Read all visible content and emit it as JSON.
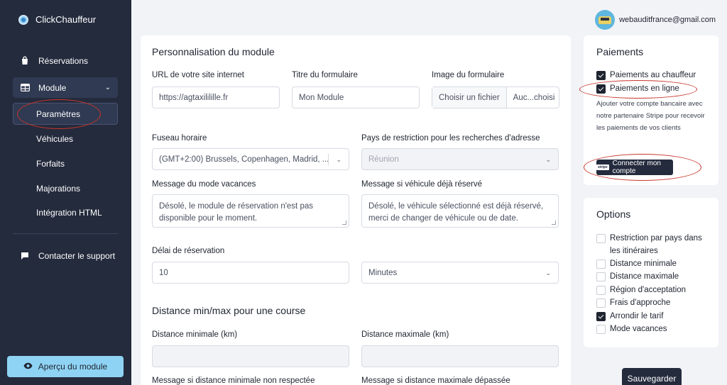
{
  "sidebar": {
    "brand": "ClickChauffeur",
    "items": [
      {
        "label": "Réservations"
      },
      {
        "label": "Module"
      }
    ],
    "sub_items": [
      {
        "label": "Paramètres"
      },
      {
        "label": "Véhicules"
      },
      {
        "label": "Forfaits"
      },
      {
        "label": "Majorations"
      },
      {
        "label": "Intégration HTML"
      }
    ],
    "support": "Contacter le support",
    "preview_button": "Aperçu du module"
  },
  "user": {
    "email": "webauditfrance@gmail.com"
  },
  "main": {
    "title": "Personnalisation du module",
    "url_label": "URL de votre site internet",
    "url_value": "https://agtaxililille.fr",
    "form_title_label": "Titre du formulaire",
    "form_title_value": "Mon Module",
    "image_label": "Image du formulaire",
    "image_button": "Choisir un fichier",
    "image_value": "Auc...choisi",
    "timezone_label": "Fuseau horaire",
    "timezone_value": "(GMT+2:00) Brussels, Copenhagen, Madrid, ...",
    "country_label": "Pays de restriction pour les recherches d'adresse",
    "country_value": "Réunion",
    "vacation_label": "Message du mode vacances",
    "vacation_value": "Désolé, le module de réservation n'est pas disponible pour le moment.",
    "reserved_label": "Message si véhicule déjà réservé",
    "reserved_value": "Désolé, le véhicule sélectionné est déjà réservé, merci de changer de véhicule ou de date.",
    "delay_label": "Délai de réservation",
    "delay_value": "10",
    "delay_unit": "Minutes",
    "distance_title": "Distance min/max pour une course",
    "min_label": "Distance minimale (km)",
    "max_label": "Distance maximale (km)",
    "min_msg_label": "Message si distance minimale non respectée",
    "max_msg_label": "Message si distance maximale dépassée"
  },
  "payments": {
    "title": "Paiements",
    "options": [
      {
        "label": "Paiements au chauffeur",
        "checked": true
      },
      {
        "label": "Paiements en ligne",
        "checked": true
      }
    ],
    "description": "Ajouter votre compte bancaire avec notre partenaire Stripe pour recevoir les paiements de vos clients",
    "stripe_mark": "stripe",
    "connect_button": "Connecter mon compte"
  },
  "options": {
    "title": "Options",
    "items": [
      {
        "label": "Restriction par pays dans les itinéraires",
        "checked": false
      },
      {
        "label": "Distance minimale",
        "checked": false
      },
      {
        "label": "Distance maximale",
        "checked": false
      },
      {
        "label": "Région d'acceptation",
        "checked": false
      },
      {
        "label": "Frais d'approche",
        "checked": false
      },
      {
        "label": "Arrondir le tarif",
        "checked": true
      },
      {
        "label": "Mode vacances",
        "checked": false
      }
    ]
  },
  "save_button": "Sauvegarder",
  "colors": {
    "sidebar": "#242b3d",
    "accent": "#8fd3f4",
    "annotation": "#c8352b"
  }
}
